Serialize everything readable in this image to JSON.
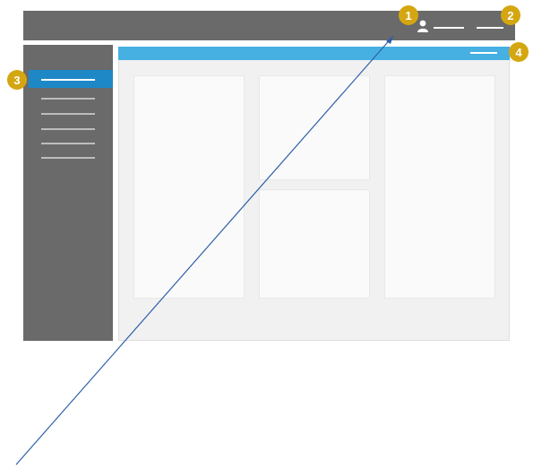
{
  "callouts": [
    {
      "id": "1",
      "label": "1"
    },
    {
      "id": "2",
      "label": "2"
    },
    {
      "id": "3",
      "label": "3"
    },
    {
      "id": "4",
      "label": "4"
    }
  ],
  "colors": {
    "chrome": "#6a6a6a",
    "accent_blue": "#46b0e3",
    "active_nav": "#1e88c7",
    "badge": "#d4a611",
    "pointer_line": "#2f5fa8"
  },
  "sidebar": {
    "item_count": 6,
    "active_index": 0
  },
  "icons": {
    "user": "user-icon"
  }
}
